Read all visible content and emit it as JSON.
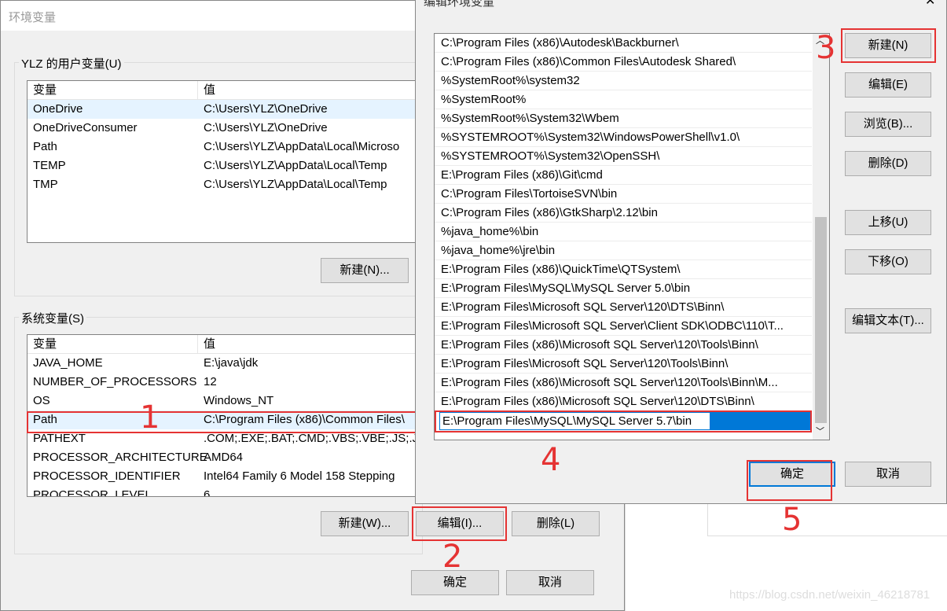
{
  "env_dialog": {
    "title": "环境变量",
    "user_group": "YLZ 的用户变量(U)",
    "col_var": "变量",
    "col_val": "值",
    "user_vars": [
      [
        "OneDrive",
        "C:\\Users\\YLZ\\OneDrive"
      ],
      [
        "OneDriveConsumer",
        "C:\\Users\\YLZ\\OneDrive"
      ],
      [
        "Path",
        "C:\\Users\\YLZ\\AppData\\Local\\Microso"
      ],
      [
        "TEMP",
        "C:\\Users\\YLZ\\AppData\\Local\\Temp"
      ],
      [
        "TMP",
        "C:\\Users\\YLZ\\AppData\\Local\\Temp"
      ]
    ],
    "user_new": "新建(N)...",
    "sys_group": "系统变量(S)",
    "sys_vars": [
      [
        "JAVA_HOME",
        "E:\\java\\jdk"
      ],
      [
        "NUMBER_OF_PROCESSORS",
        "12"
      ],
      [
        "OS",
        "Windows_NT"
      ],
      [
        "Path",
        "C:\\Program Files (x86)\\Common Files\\"
      ],
      [
        "PATHEXT",
        ".COM;.EXE;.BAT;.CMD;.VBS;.VBE;.JS;.JS"
      ],
      [
        "PROCESSOR_ARCHITECTURE",
        "AMD64"
      ],
      [
        "PROCESSOR_IDENTIFIER",
        "Intel64 Family 6 Model 158 Stepping"
      ],
      [
        "PROCESSOR_LEVEL",
        "6"
      ]
    ],
    "sys_new": "新建(W)...",
    "sys_edit": "编辑(I)...",
    "sys_delete": "删除(L)",
    "ok": "确定",
    "cancel": "取消"
  },
  "edit_dialog": {
    "title": "编辑环境变量",
    "entries": [
      "C:\\Program Files (x86)\\Autodesk\\Backburner\\",
      "C:\\Program Files (x86)\\Common Files\\Autodesk Shared\\",
      "%SystemRoot%\\system32",
      "%SystemRoot%",
      "%SystemRoot%\\System32\\Wbem",
      "%SYSTEMROOT%\\System32\\WindowsPowerShell\\v1.0\\",
      "%SYSTEMROOT%\\System32\\OpenSSH\\",
      "E:\\Program Files (x86)\\Git\\cmd",
      "C:\\Program Files\\TortoiseSVN\\bin",
      "C:\\Program Files (x86)\\GtkSharp\\2.12\\bin",
      "%java_home%\\bin",
      "%java_home%\\jre\\bin",
      "E:\\Program Files (x86)\\QuickTime\\QTSystem\\",
      "E:\\Program Files\\MySQL\\MySQL Server 5.0\\bin",
      "E:\\Program Files\\Microsoft SQL Server\\120\\DTS\\Binn\\",
      "E:\\Program Files\\Microsoft SQL Server\\Client SDK\\ODBC\\110\\T...",
      "E:\\Program Files (x86)\\Microsoft SQL Server\\120\\Tools\\Binn\\",
      "E:\\Program Files\\Microsoft SQL Server\\120\\Tools\\Binn\\",
      "E:\\Program Files (x86)\\Microsoft SQL Server\\120\\Tools\\Binn\\M...",
      "E:\\Program Files (x86)\\Microsoft SQL Server\\120\\DTS\\Binn\\"
    ],
    "editing_value": "E:\\Program Files\\MySQL\\MySQL Server 5.7\\bin",
    "buttons": {
      "new": "新建(N)",
      "edit": "编辑(E)",
      "browse": "浏览(B)...",
      "delete": "删除(D)",
      "up": "上移(U)",
      "down": "下移(O)",
      "edit_text": "编辑文本(T)..."
    },
    "ok": "确定",
    "cancel": "取消"
  },
  "annotations": [
    "1",
    "2",
    "3",
    "4",
    "5"
  ],
  "watermark": "https://blog.csdn.net/weixin_46218781"
}
